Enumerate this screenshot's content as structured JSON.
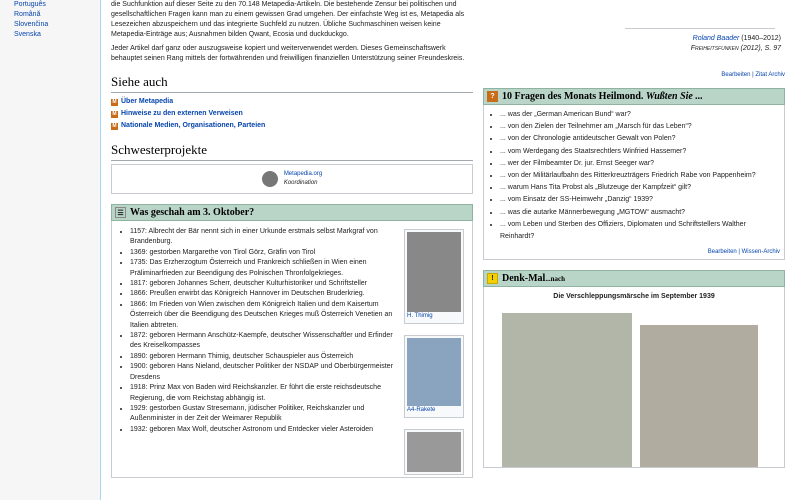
{
  "sidebar": {
    "languages": [
      "Português",
      "Română",
      "Slovenčina",
      "Svenska"
    ]
  },
  "intro": {
    "para1": "die Suchfunktion auf dieser Seite zu den 70.148 Metapedia-Artikeln. Die bestehende Zensur bei politischen und gesellschaftlichen Fragen kann man zu einem gewissen Grad umgehen. Der einfachste Weg ist es, Metapedia als Lesezeichen abzuspeichern und das integrierte Suchfeld zu nutzen. Übliche Suchmaschinen weisen keine Metapedia-Einträge aus; Ausnahmen bilden Qwant, Ecosia und duckduckgo.",
    "para2": "Jeder Artikel darf ganz oder auszugsweise kopiert und weiterverwendet werden. Dieses Gemeinschaftswerk behauptet seinen Rang mittels der fortwährenden und freiwilligen finanziellen Unterstützung seiner Freundeskreis."
  },
  "siehe_auch": {
    "title": "Siehe auch",
    "items": [
      "Über Metapedia",
      "Hinweise zu den externen Verweisen",
      "Nationale Medien, Organisationen, Parteien"
    ]
  },
  "schwester": {
    "title": "Schwesterprojekte",
    "link": "Metapedia.org",
    "sub": "Koordination"
  },
  "was_geschah": {
    "title": "Was geschah am 3. Oktober?",
    "events": [
      "1157: Albrecht der Bär nennt sich in einer Urkunde erstmals selbst Markgraf von Brandenburg.",
      "1369: gestorben Margarethe von Tirol Görz, Gräfin von Tirol",
      "1735: Das Erzherzogtum Österreich und Frankreich schließen in Wien einen Präliminarfrieden zur Beendigung des Polnischen Thronfolgekrieges.",
      "1817: geboren Johannes Scherr, deutscher Kulturhistoriker und Schriftsteller",
      "1866: Preußen erwirbt das Königreich Hannover im Deutschen Bruderkrieg.",
      "1866: Im Frieden von Wien zwischen dem Königreich Italien und dem Kaisertum Österreich über die Beendigung des Deutschen Krieges muß Österreich Venetien an Italien abtreten.",
      "1872: geboren Hermann Anschütz-Kaempfe, deutscher Wissenschaftler und Erfinder des Kreiselkompasses",
      "1890: geboren Hermann Thimig, deutscher Schauspieler aus Österreich",
      "1900: geboren Hans Nieland, deutscher Politiker der NSDAP und Oberbürgermeister Dresdens",
      "1918: Prinz Max von Baden wird Reichskanzler. Er führt die erste reichsdeutsche Regierung, die vom Reichstag abhängig ist.",
      "1929: gestorben Gustav Stresemann, jüdischer Politiker, Reichskanzler und Außenminister in der Zeit der Weimarer Republik",
      "1932: geboren Max Wolf, deutscher Astronom und Entdecker vieler Asteroiden"
    ],
    "thumb1_caption": "H. Thimig",
    "thumb2_caption": "A4-Rakete"
  },
  "quote": {
    "author": "Roland Baader",
    "years": "(1940–2012)",
    "source": "Freiheitsfunken (2012), S. 97"
  },
  "quote_links": "Bearbeiten | Zitat Archiv",
  "fragen": {
    "title": "10 Fragen des Monats Heilmond.",
    "title_em": "Wußten Sie ...",
    "items": [
      "... was der „German American Bund“ war?",
      "... von den Zielen der Teilnehmer am „Marsch für das Leben“?",
      "... von der Chronologie antideutscher Gewalt von Polen?",
      "... vom Werdegang des Staatsrechtlers Winfried Hassemer?",
      "... wer der Filmbeamter Dr. jur. Ernst Seeger war?",
      "... von der Militärlaufbahn des Ritterkreuzträgers Friedrich Rabe von Pappenheim?",
      "... warum Hans Tita Probst als „Blutzeuge der Kampfzeit“ gilt?",
      "... vom Einsatz der SS-Heimwehr „Danzig“ 1939?",
      "... was die autarke Männerbewegung „MGTOW“ ausmacht?",
      "... vom Leben und Sterben des Offiziers, Diplomaten und Schriftstellers Walther Reinhardt?"
    ],
    "links": "Bearbeiten | Wissen-Archiv"
  },
  "denkmal": {
    "title": "Denk-Mal",
    "title_small": "...nach",
    "subtitle": "Die Verschleppungsmärsche im September 1939"
  }
}
